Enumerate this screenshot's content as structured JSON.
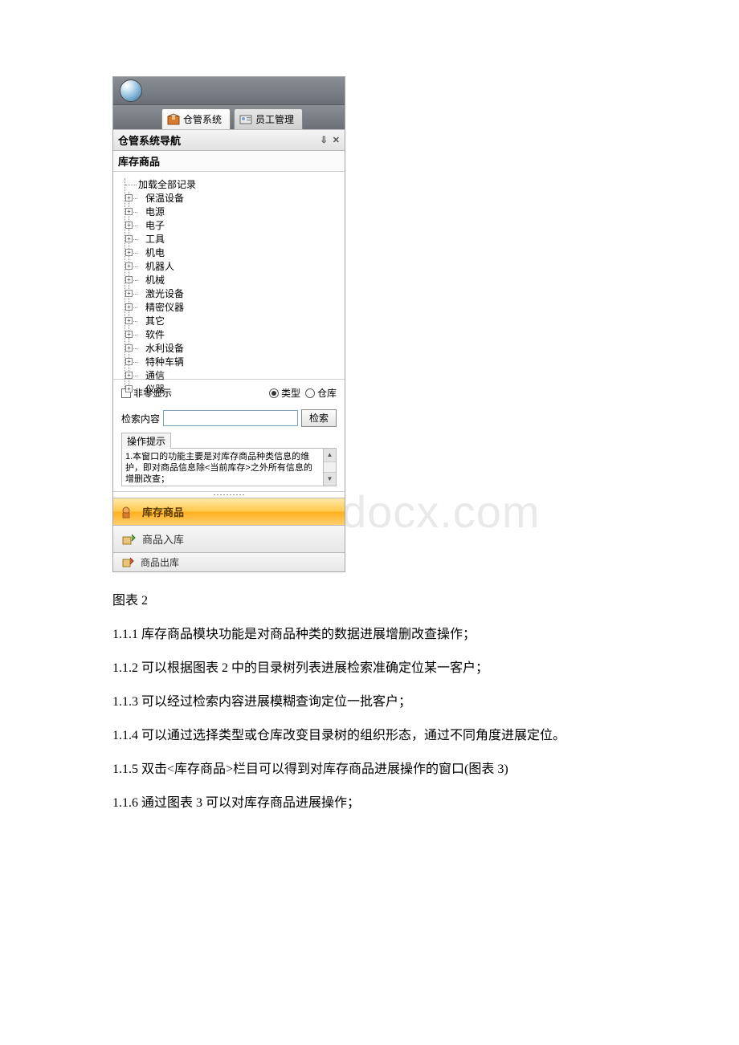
{
  "ribbon": {
    "tab1": "仓管系统",
    "tab2": "员工管理"
  },
  "nav": {
    "title": "仓管系统导航",
    "pin_glyph": "⇩",
    "close_glyph": "✕",
    "section": "库存商品"
  },
  "tree": {
    "root": "加载全部记录",
    "items": [
      "保温设备",
      "电源",
      "电子",
      "工具",
      "机电",
      "机器人",
      "机械",
      "激光设备",
      "精密仪器",
      "其它",
      "软件",
      "水利设备",
      "特种车辆",
      "通信",
      "仪器"
    ]
  },
  "filters": {
    "nonzero": "非零显示",
    "type": "类型",
    "warehouse": "仓库"
  },
  "search": {
    "label": "检索内容",
    "button": "检索"
  },
  "tips": {
    "label": "操作提示",
    "text": "1.本窗口的功能主要是对库存商品种类信息的维护，即对商品信息除<当前库存>之外所有信息的增删改查；"
  },
  "navbar": {
    "item1": "库存商品",
    "item2": "商品入库",
    "item3": "商品出库"
  },
  "watermark": "www.bdocx.com",
  "doc": {
    "caption": "图表 2",
    "p1": "1.1.1 库存商品模块功能是对商品种类的数据进展增删改查操作；",
    "p2": "1.1.2 可以根据图表 2 中的目录树列表进展检索准确定位某一客户；",
    "p3": "1.1.3 可以经过检索内容进展模糊查询定位一批客户；",
    "p4": "1.1.4 可以通过选择类型或仓库改变目录树的组织形态，通过不同角度进展定位。",
    "p5": "1.1.5 双击<库存商品>栏目可以得到对库存商品进展操作的窗口(图表 3)",
    "p6": "1.1.6 通过图表 3 可以对库存商品进展操作；"
  }
}
